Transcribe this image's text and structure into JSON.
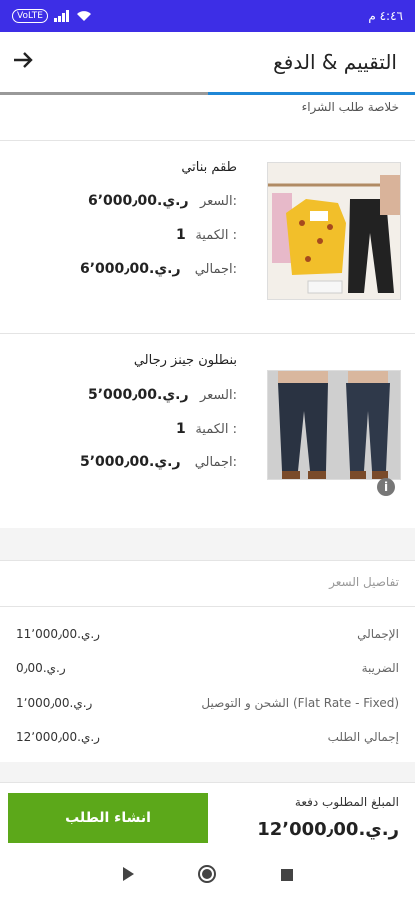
{
  "status_bar": {
    "time": "٤:٤٦ م",
    "vo_badge": "VoLTE",
    "signal_icon": "signal-icon",
    "wifi_icon": "wifi-icon"
  },
  "app_bar": {
    "title": "التقييم & الدفع",
    "back_icon": "arrow-right-icon"
  },
  "summary": {
    "title": "خلاصة طلب الشراء"
  },
  "products": [
    {
      "name": "طقم بناتي",
      "price_label": "السعر:",
      "price_value": "ر.ي.6٬000٫00",
      "quantity_label": "الكمية :",
      "quantity_value": "1",
      "total_label": "اجمالي:",
      "total_value": "ر.ي.6٬000٫00",
      "image": "girls-outfit-image"
    },
    {
      "name": "بنطلون جينز رجالي",
      "price_label": "السعر:",
      "price_value": "ر.ي.5٬000٫00",
      "quantity_label": "الكمية :",
      "quantity_value": "1",
      "total_label": "اجمالي:",
      "total_value": "ر.ي.5٬000٫00",
      "image": "mens-jeans-image"
    }
  ],
  "price_details": {
    "header": "تفاصيل السعر",
    "rows": [
      {
        "label": "الإجمالي",
        "value": "ر.ي.11٬000٫00"
      },
      {
        "label": "الضريبة",
        "value": "ر.ي.0٫00"
      },
      {
        "label": "الشحن و التوصيل (Flat Rate - Fixed)",
        "value": "ر.ي.1٬000٫00"
      },
      {
        "label": "إجمالي الطلب",
        "value": "ر.ي.12٬000٫00"
      }
    ]
  },
  "footer": {
    "amount_label": "المبلغ المطلوب دفعة",
    "amount_value": "ر.ي.12٬000٫00",
    "create_button": "انشاء الطلب"
  },
  "nav": {
    "back": "play-icon",
    "home": "circle-icon",
    "recent": "square-icon"
  },
  "colors": {
    "status_bar": "#3d2ee6",
    "progress": "#1f87d6",
    "button": "#5ca81a"
  }
}
